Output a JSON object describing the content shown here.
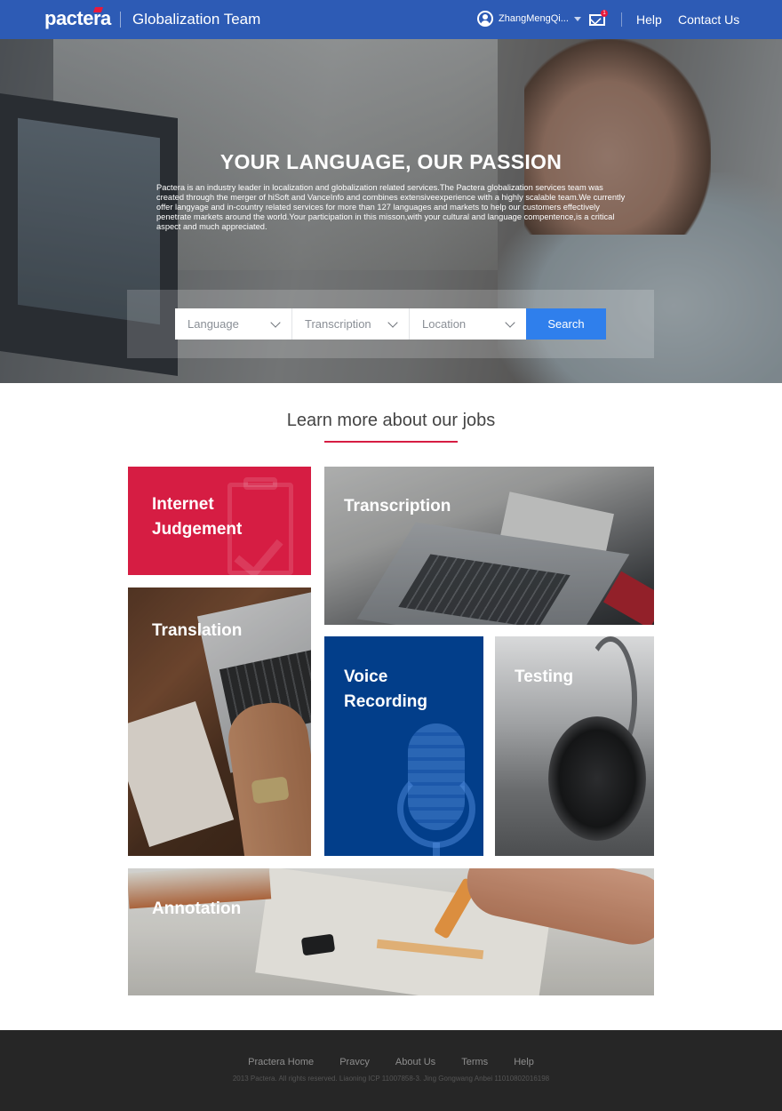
{
  "header": {
    "logo": "pactera",
    "team": "Globalization Team",
    "username": "ZhangMengQi...",
    "mail_badge": "1",
    "nav": {
      "help": "Help",
      "contact": "Contact Us"
    }
  },
  "hero": {
    "title": "YOUR LANGUAGE, OUR PASSION",
    "text": "Pactera is an industry leader in localization and globalization related services.The Pactera globalization services team was created through the merger of hiSoft and VanceInfo and combines extensiveexperience with a highly scalable team.We currently offer langyage and in-country related services for more than 127 languages and markets to help our customers effectively penetrate markets around the world.Your participation in this misson,with your cultural and language compentence,is a critical aspect and much appreciated.",
    "search": {
      "language": "Language",
      "type": "Transcription",
      "location": "Location",
      "button": "Search"
    }
  },
  "jobs": {
    "title": "Learn more about our jobs",
    "tiles": {
      "internet_line1": "Internet",
      "internet_line2": "Judgement",
      "transcription": "Transcription",
      "translation": "Translation",
      "voice_line1": "Voice",
      "voice_line2": "Recording",
      "testing": "Testing",
      "annotation": "Annotation"
    },
    "colors": {
      "accent_red": "#d61d43",
      "voice_blue": "#023e8a",
      "search_blue": "#2f7fec",
      "header_blue": "#2d5bb5"
    }
  },
  "footer": {
    "links": [
      "Practera Home",
      "Pravcy",
      "About Us",
      "Terms",
      "Help"
    ],
    "copyright": "2013 Pactera. All rights reserved. Liaoning ICP 11007858-3. Jing Gongwang Anbei 11010802016198"
  }
}
